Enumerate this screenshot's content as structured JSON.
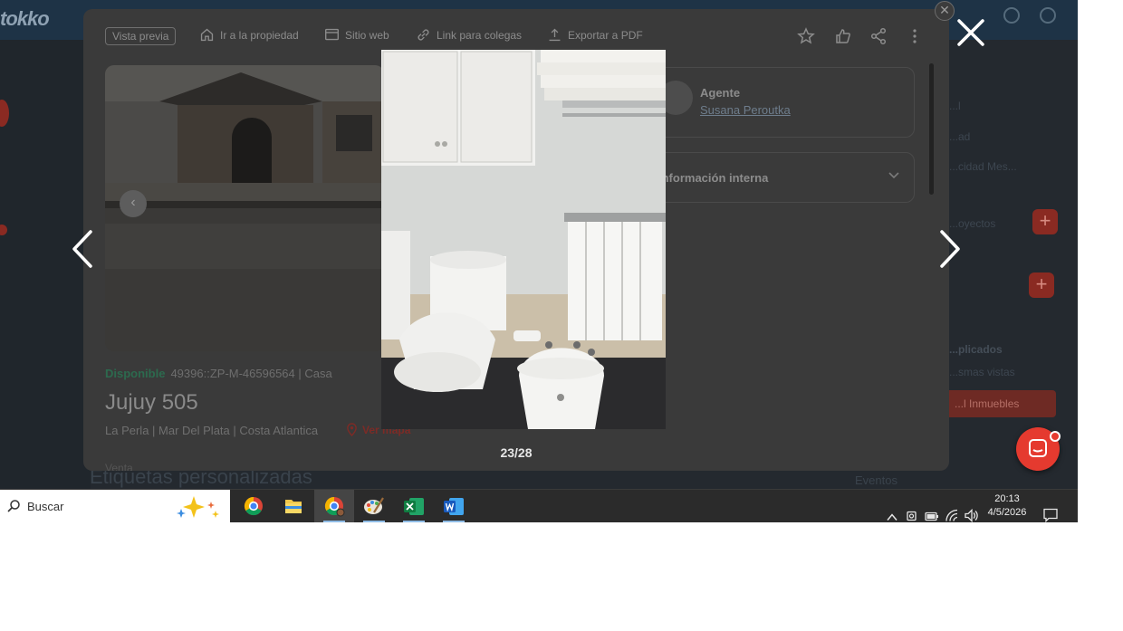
{
  "app": {
    "logo": "tokko",
    "underlay_heading": "Etiquetas personalizadas",
    "underlay_eventos": "Eventos",
    "right_panel_texts": [
      "...l",
      "...ad",
      "...cidad Mes...",
      "...oyectos",
      "...plicados",
      "...smas vistas",
      "...l Inmuebles"
    ]
  },
  "modal": {
    "toolbar": {
      "preview_badge": "Vista previa",
      "go_to_property": "Ir a la propiedad",
      "website": "Sitio web",
      "colleague_link": "Link para colegas",
      "export_pdf": "Exportar a PDF"
    },
    "property": {
      "status": "Disponible",
      "code": "49396::ZP-M-46596564 | Casa",
      "title": "Jujuy 505",
      "location": "La Perla | Mar Del Plata | Costa Atlantica",
      "map_link": "Ver mapa",
      "tag_partial": "Venta"
    },
    "agent": {
      "role": "Agente",
      "name": "Susana Peroutka"
    },
    "internal_info_label": "Información interna"
  },
  "lightbox": {
    "counter": "23/28",
    "close_symbol": "✕"
  },
  "taskbar": {
    "search_label": "Buscar",
    "apps": [
      "chrome-icon",
      "file-explorer-icon",
      "chrome-profile-icon",
      "paint-icon",
      "excel-icon",
      "word-icon"
    ],
    "time": "20:13",
    "date": "4/5/2026"
  },
  "colors": {
    "accent_red": "#e53a2f",
    "available_green": "#2c6a4e",
    "taskbar_bg": "#2b2b2b"
  }
}
